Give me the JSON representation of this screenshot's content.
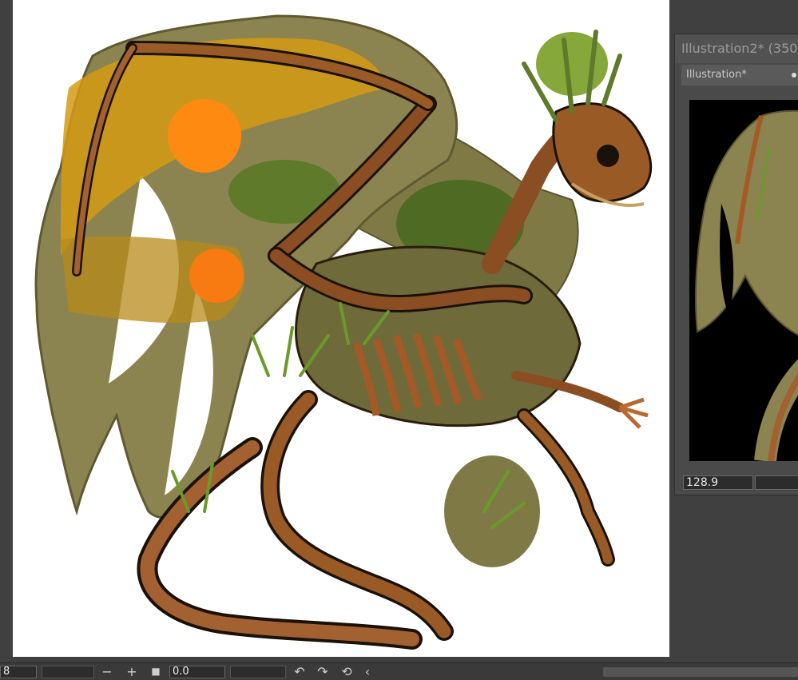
{
  "canvas": {
    "background": "#ffffff",
    "artwork": "dragon-skeleton-illustration",
    "palette": {
      "wing_membrane": "#8b8450",
      "bone": "#8a4e22",
      "bone_highlight": "#c97a3a",
      "outline": "#1a1208",
      "moss": "#5e7a2a",
      "leaf": "#86a83a",
      "sun": "#ff8a12",
      "amber": "#d99a10"
    }
  },
  "navigator": {
    "title": "Illustration2* (350",
    "tab_label": "Illustration*",
    "zoom_value": "128.9"
  },
  "bottom_toolbar": {
    "left_value": "8",
    "minus": "−",
    "plus": "+",
    "stop": "■",
    "angle_value": "0.0",
    "undo": "↶",
    "redo": "↷",
    "reset": "⟲",
    "collapse": "‹"
  }
}
